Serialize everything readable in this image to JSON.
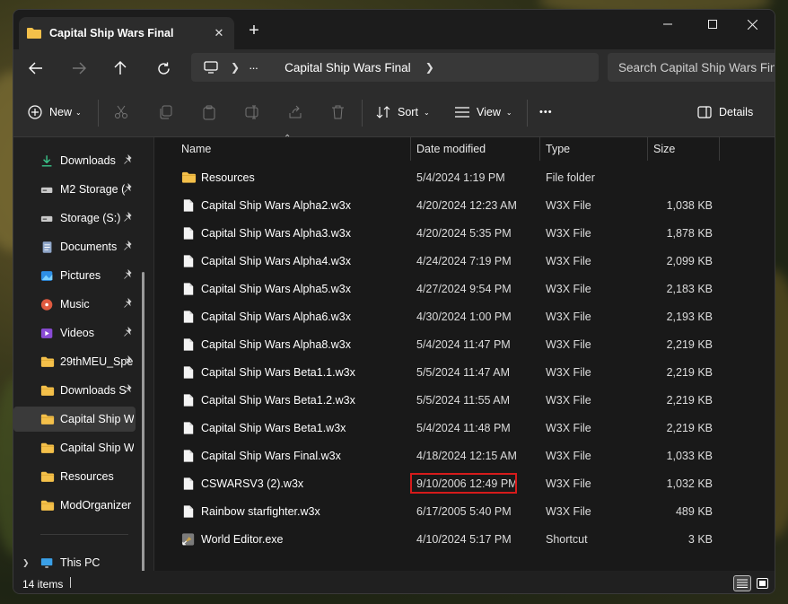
{
  "window": {
    "tab_title": "Capital Ship Wars Final",
    "tab_close": "✕",
    "new_tab": "+"
  },
  "address": {
    "ellipsis": "···",
    "crumb": "Capital Ship Wars Final",
    "search_placeholder": "Search Capital Ship Wars Final"
  },
  "toolbar": {
    "new_label": "New",
    "sort_label": "Sort",
    "view_label": "View",
    "more_label": "•••",
    "details_label": "Details"
  },
  "sidebar": {
    "items": [
      {
        "label": "Downloads",
        "icon": "download-icon",
        "pinned": true
      },
      {
        "label": "M2 Storage (",
        "icon": "drive-icon",
        "pinned": true
      },
      {
        "label": "Storage (S:)",
        "icon": "drive-icon",
        "pinned": true
      },
      {
        "label": "Documents",
        "icon": "documents-icon",
        "pinned": true
      },
      {
        "label": "Pictures",
        "icon": "pictures-icon",
        "pinned": true
      },
      {
        "label": "Music",
        "icon": "music-icon",
        "pinned": true
      },
      {
        "label": "Videos",
        "icon": "videos-icon",
        "pinned": true
      },
      {
        "label": "29thMEU_Spe",
        "icon": "folder-icon",
        "pinned": true
      },
      {
        "label": "Downloads S",
        "icon": "folder-icon",
        "pinned": true
      },
      {
        "label": "Capital Ship Wa",
        "icon": "folder-icon",
        "pinned": false,
        "selected": true
      },
      {
        "label": "Capital Ship Wa",
        "icon": "folder-icon",
        "pinned": false
      },
      {
        "label": "Resources",
        "icon": "folder-icon",
        "pinned": false
      },
      {
        "label": "ModOrganizer",
        "icon": "folder-icon",
        "pinned": false
      }
    ],
    "this_pc": "This PC"
  },
  "columns": {
    "name": "Name",
    "date": "Date modified",
    "type": "Type",
    "size": "Size"
  },
  "files": [
    {
      "name": "Resources",
      "date": "5/4/2024 1:19 PM",
      "type": "File folder",
      "size": "",
      "icon": "folder-icon"
    },
    {
      "name": "Capital Ship Wars Alpha2.w3x",
      "date": "4/20/2024 12:23 AM",
      "type": "W3X File",
      "size": "1,038 KB",
      "icon": "file-icon"
    },
    {
      "name": "Capital Ship Wars Alpha3.w3x",
      "date": "4/20/2024 5:35 PM",
      "type": "W3X File",
      "size": "1,878 KB",
      "icon": "file-icon"
    },
    {
      "name": "Capital Ship Wars Alpha4.w3x",
      "date": "4/24/2024 7:19 PM",
      "type": "W3X File",
      "size": "2,099 KB",
      "icon": "file-icon"
    },
    {
      "name": "Capital Ship Wars Alpha5.w3x",
      "date": "4/27/2024 9:54 PM",
      "type": "W3X File",
      "size": "2,183 KB",
      "icon": "file-icon"
    },
    {
      "name": "Capital Ship Wars Alpha6.w3x",
      "date": "4/30/2024 1:00 PM",
      "type": "W3X File",
      "size": "2,193 KB",
      "icon": "file-icon"
    },
    {
      "name": "Capital Ship Wars Alpha8.w3x",
      "date": "5/4/2024 11:47 PM",
      "type": "W3X File",
      "size": "2,219 KB",
      "icon": "file-icon"
    },
    {
      "name": "Capital Ship Wars Beta1.1.w3x",
      "date": "5/5/2024 11:47 AM",
      "type": "W3X File",
      "size": "2,219 KB",
      "icon": "file-icon"
    },
    {
      "name": "Capital Ship Wars Beta1.2.w3x",
      "date": "5/5/2024 11:55 AM",
      "type": "W3X File",
      "size": "2,219 KB",
      "icon": "file-icon"
    },
    {
      "name": "Capital Ship Wars Beta1.w3x",
      "date": "5/4/2024 11:48 PM",
      "type": "W3X File",
      "size": "2,219 KB",
      "icon": "file-icon"
    },
    {
      "name": "Capital Ship Wars Final.w3x",
      "date": "4/18/2024 12:15 AM",
      "type": "W3X File",
      "size": "1,033 KB",
      "icon": "file-icon"
    },
    {
      "name": "CSWARSV3 (2).w3x",
      "date": "9/10/2006 12:49 PM",
      "type": "W3X File",
      "size": "1,032 KB",
      "icon": "file-icon",
      "highlight": true
    },
    {
      "name": "Rainbow starfighter.w3x",
      "date": "6/17/2005 5:40 PM",
      "type": "W3X File",
      "size": "489 KB",
      "icon": "file-icon"
    },
    {
      "name": "World Editor.exe",
      "date": "4/10/2024 5:17 PM",
      "type": "Shortcut",
      "size": "3 KB",
      "icon": "shortcut-icon"
    }
  ],
  "status": {
    "item_count": "14 items"
  },
  "colors": {
    "highlight": "#d61b1b",
    "folder": "#f4c04a",
    "accent": "#4cc2ff"
  }
}
